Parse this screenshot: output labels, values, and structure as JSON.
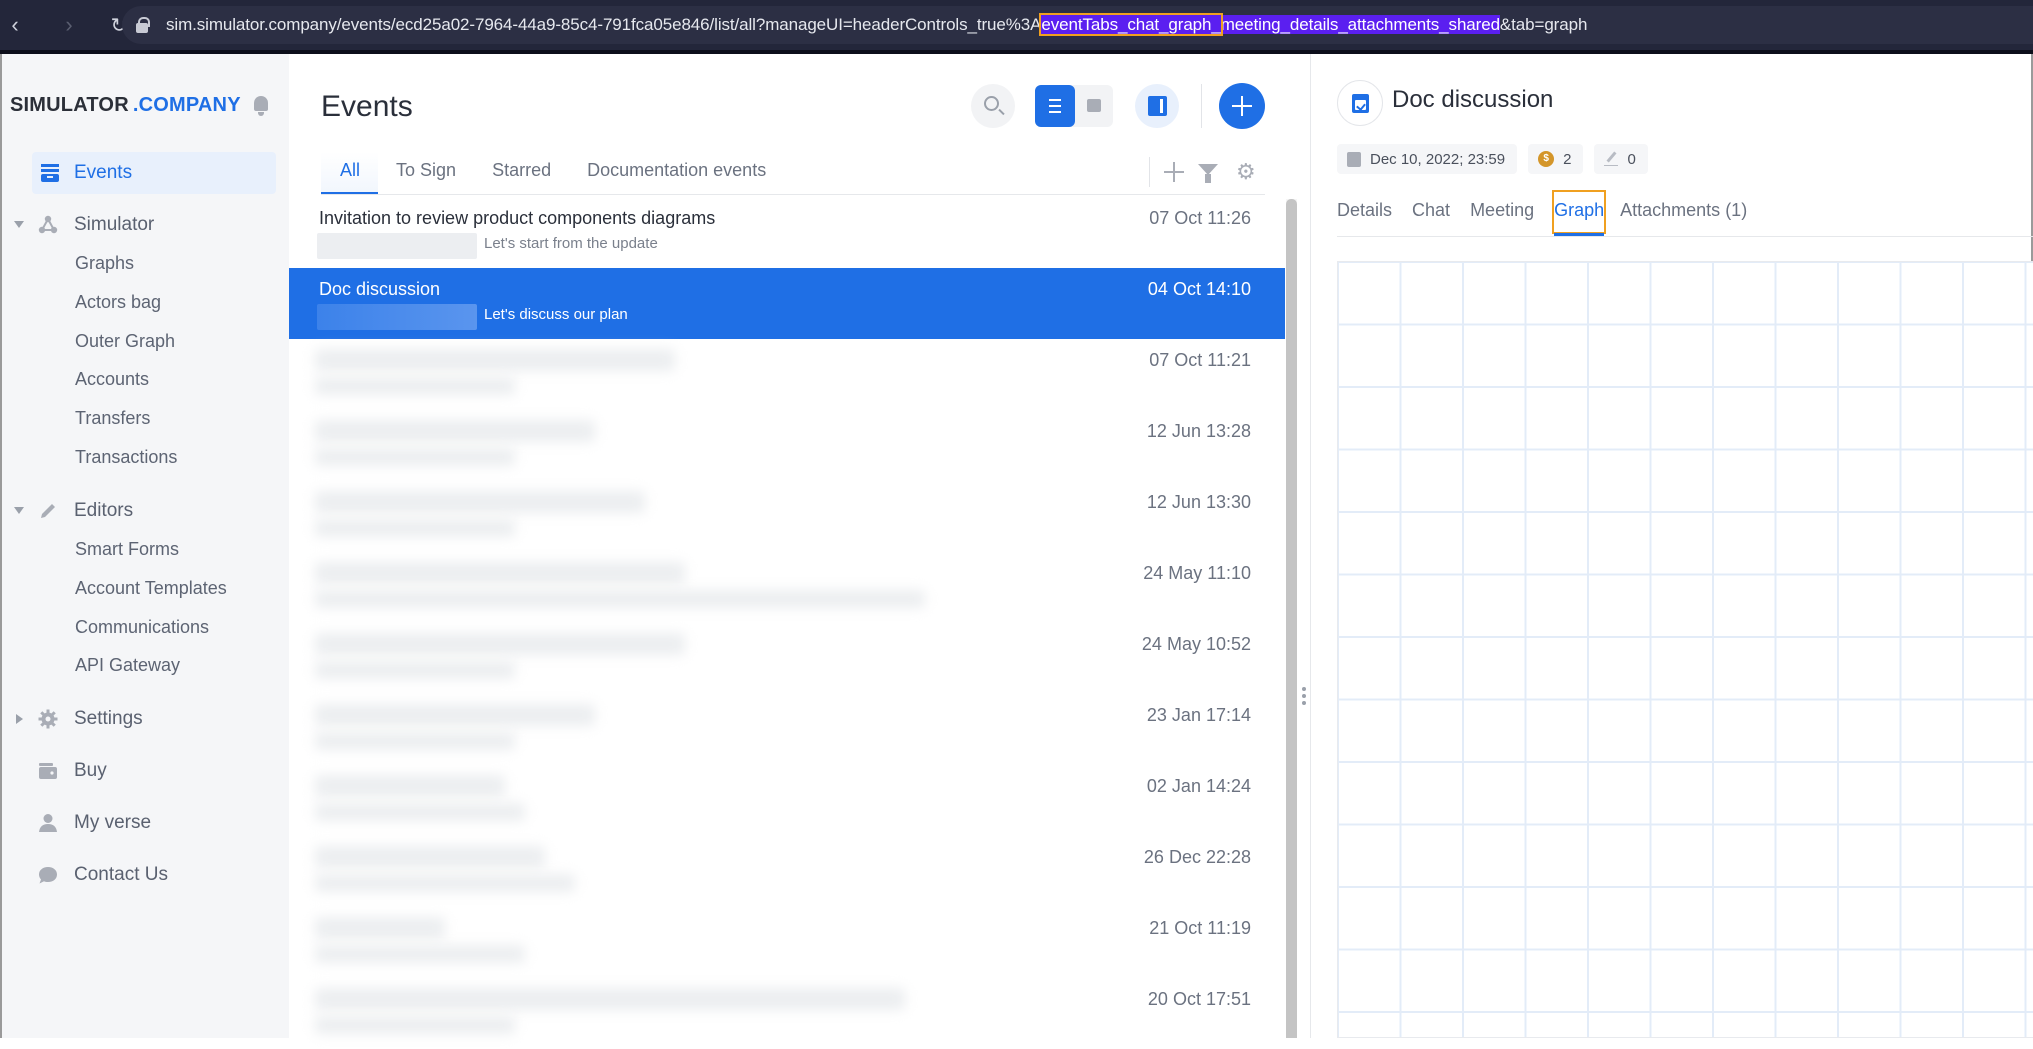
{
  "browser": {
    "url_prefix": "sim.simulator.company/events/ecd25a02-7964-44a9-85c4-791fca05e846/list/all?manageUI=headerControls_true%3A",
    "url_highlight_boxed": "eventTabs_chat_graph_",
    "url_highlight": "meeting_details_attachments_shared",
    "url_suffix": "&tab=graph",
    "back_icon": "‹",
    "forward_icon": "›",
    "reload_icon": "↻"
  },
  "sidebar": {
    "brand_part1": "SIMULATOR",
    "brand_part2": ".COMPANY",
    "items": [
      {
        "label": "Events",
        "icon": "events-icon",
        "active": true
      },
      {
        "label": "Simulator",
        "icon": "simulator-icon",
        "expanded": true
      },
      {
        "label": "Editors",
        "icon": "pencil-icon",
        "expanded": true
      },
      {
        "label": "Settings",
        "icon": "gear-icon",
        "expanded": false
      },
      {
        "label": "Buy",
        "icon": "wallet-icon"
      },
      {
        "label": "My verse",
        "icon": "user-icon"
      },
      {
        "label": "Contact Us",
        "icon": "chat-bubble-icon"
      }
    ],
    "simulator_children": [
      "Graphs",
      "Actors bag",
      "Outer Graph",
      "Accounts",
      "Transfers",
      "Transactions"
    ],
    "editors_children": [
      "Smart Forms",
      "Account Templates",
      "Communications",
      "API Gateway"
    ]
  },
  "events": {
    "title": "Events",
    "tabs": [
      {
        "label": "All",
        "active": true
      },
      {
        "label": "To Sign"
      },
      {
        "label": "Starred"
      },
      {
        "label": "Documentation events"
      }
    ],
    "rows": [
      {
        "title": "Invitation to review product components diagrams",
        "subtitle": "Let's start from the update",
        "date": "07 Oct 11:26",
        "selected": false
      },
      {
        "title": "Doc discussion",
        "subtitle": "Let's discuss our plan",
        "date": "04 Oct 14:10",
        "selected": true
      },
      {
        "title": "",
        "subtitle": "",
        "date": "07 Oct 11:21",
        "blurred": true
      },
      {
        "title": "",
        "subtitle": "",
        "date": "12 Jun 13:28",
        "blurred": true
      },
      {
        "title": "",
        "subtitle": "",
        "date": "12 Jun 13:30",
        "blurred": true
      },
      {
        "title": "",
        "subtitle": "",
        "date": "24 May 11:10",
        "blurred": true
      },
      {
        "title": "",
        "subtitle": "",
        "date": "24 May 10:52",
        "blurred": true
      },
      {
        "title": "",
        "subtitle": "",
        "date": "23 Jan 17:14",
        "blurred": true
      },
      {
        "title": "",
        "subtitle": "",
        "date": "02 Jan 14:24",
        "blurred": true
      },
      {
        "title": "",
        "subtitle": "",
        "date": "26 Dec 22:28",
        "blurred": true
      },
      {
        "title": "",
        "subtitle": "",
        "date": "21 Oct 11:19",
        "blurred": true
      },
      {
        "title": "",
        "subtitle": "",
        "date": "20 Oct 17:51",
        "blurred": true
      }
    ]
  },
  "detail": {
    "title": "Doc discussion",
    "date_chip": "Dec 10, 2022; 23:59",
    "coin_symbol": "$",
    "coin_count": "2",
    "sign_count": "0",
    "tabs": [
      {
        "label": "Details"
      },
      {
        "label": "Chat"
      },
      {
        "label": "Meeting"
      },
      {
        "label": "Graph",
        "active": true
      },
      {
        "label": "Attachments (1)"
      }
    ]
  },
  "colors": {
    "accent": "#1f6fe5",
    "highlight_box": "#f0a020",
    "url_selection": "#5b1ff0",
    "sidebar_bg": "#f5f6f8",
    "grid_line": "#e3ecf8"
  }
}
